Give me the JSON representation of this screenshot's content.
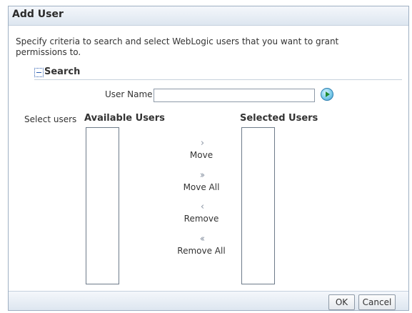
{
  "dialog": {
    "title": "Add User",
    "instructions": "Specify criteria to search and select WebLogic users that you want to grant permissions to."
  },
  "search": {
    "header": "Search",
    "user_name_label": "User Name",
    "user_name_value": "",
    "go_icon": "go-arrow-icon"
  },
  "shuttle": {
    "select_label": "Select users",
    "available_header": "Available Users",
    "selected_header": "Selected Users",
    "available_items": [],
    "selected_items": [],
    "buttons": {
      "move": "Move",
      "move_all": "Move All",
      "remove": "Remove",
      "remove_all": "Remove All"
    }
  },
  "footer": {
    "ok_label": "OK",
    "cancel_label": "Cancel"
  },
  "colors": {
    "title_bar_bg": "#dde6f0",
    "border": "#9fb0c3",
    "go_button": "#3c99c9"
  }
}
